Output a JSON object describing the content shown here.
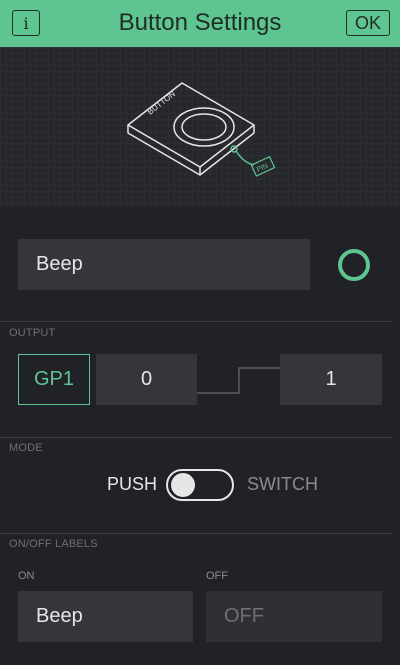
{
  "header": {
    "title": "Button Settings",
    "info_label": "i",
    "ok_label": "OK"
  },
  "hero": {
    "device_label": "BUTTON",
    "pin_label": "PIN"
  },
  "name_field": {
    "value": "Beep"
  },
  "color": {
    "accent": "#5ec490"
  },
  "output": {
    "section_label": "OUTPUT",
    "pin": "GP1",
    "low_value": "0",
    "high_value": "1"
  },
  "mode": {
    "section_label": "MODE",
    "push_label": "PUSH",
    "switch_label": "SWITCH",
    "selected": "PUSH"
  },
  "labels": {
    "section_label": "ON/OFF LABELS",
    "on_label": "ON",
    "off_label": "OFF",
    "on_value": "Beep",
    "off_placeholder": "OFF"
  }
}
